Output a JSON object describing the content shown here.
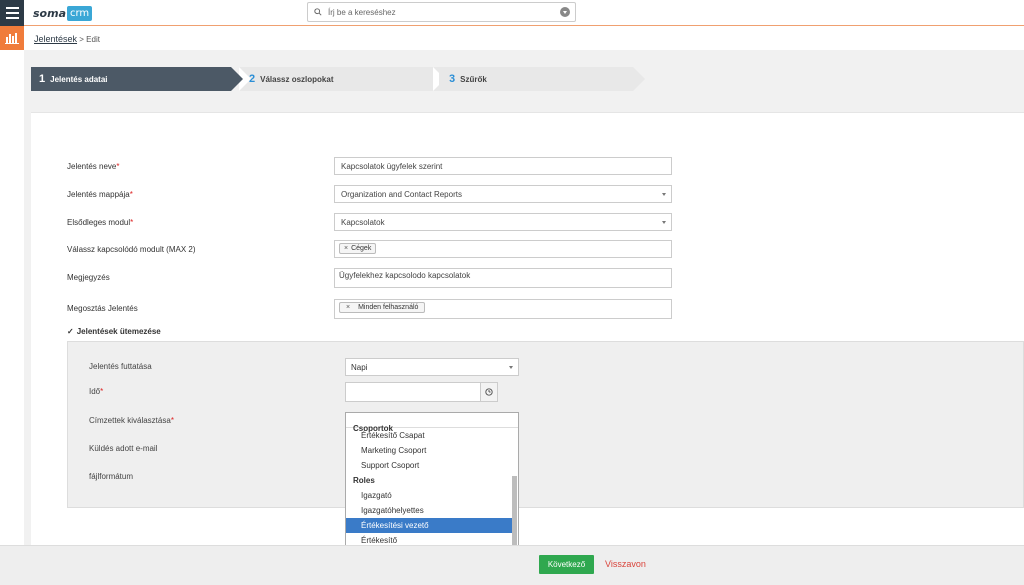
{
  "app": {
    "logo_text": "soma",
    "logo_badge": "crm",
    "search_placeholder": "Írj be a kereséshez"
  },
  "breadcrumb": {
    "section": "Jelentések",
    "separator": ">",
    "current": "Edit"
  },
  "steps": [
    {
      "num": "1",
      "label": "Jelentés adatai",
      "active": true
    },
    {
      "num": "2",
      "label": "Válassz oszlopokat",
      "active": false
    },
    {
      "num": "3",
      "label": "Szűrők",
      "active": false
    }
  ],
  "form": {
    "name_label": "Jelentés neve",
    "name_value": "Kapcsolatok ügyfelek szerint",
    "folder_label": "Jelentés mappája",
    "folder_value": "Organization and Contact Reports",
    "module_label": "Elsődleges modul",
    "module_value": "Kapcsolatok",
    "related_label": "Válassz kapcsolódó modult (MAX 2)",
    "related_chip": "Cégek",
    "note_label": "Megjegyzés",
    "note_value": "Ügyfelekhez kapcsolodo kapcsolatok",
    "share_label": "Megosztás Jelentés",
    "share_chip": "Minden felhasználó",
    "required_mark": "*",
    "chip_remove": "×"
  },
  "schedule": {
    "toggle_label": "Jelentések ütemezése",
    "check_mark": "✓",
    "run_label": "Jelentés futtatása",
    "run_value": "Napi",
    "time_label": "Idő",
    "recipients_label": "Címzettek kiválasztása",
    "email_label": "Küldés adott e-mail",
    "format_label": "fájlformátum"
  },
  "dropdown": {
    "partial_group": "Csoportok",
    "items": [
      {
        "label": "Értékesítő Csapat",
        "type": "item",
        "selected": false
      },
      {
        "label": "Marketing Csoport",
        "type": "item",
        "selected": false
      },
      {
        "label": "Support Csoport",
        "type": "item",
        "selected": false
      },
      {
        "label": "Roles",
        "type": "group",
        "selected": false
      },
      {
        "label": "Igazgató",
        "type": "item",
        "selected": false
      },
      {
        "label": "Igazgatóhelyettes",
        "type": "item",
        "selected": false
      },
      {
        "label": "Értékesítési vezető",
        "type": "item",
        "selected": true
      },
      {
        "label": "Értékesítő",
        "type": "item",
        "selected": false
      }
    ]
  },
  "footer": {
    "next_label": "Következő",
    "cancel_label": "Visszavon"
  },
  "colors": {
    "nav_dark": "#2d3a46",
    "accent_orange": "#f07c3b",
    "step_blue": "#2a8ed6",
    "selected_blue": "#3a7bc8",
    "next_green": "#2fa84f",
    "cancel_red": "#d9433a"
  }
}
